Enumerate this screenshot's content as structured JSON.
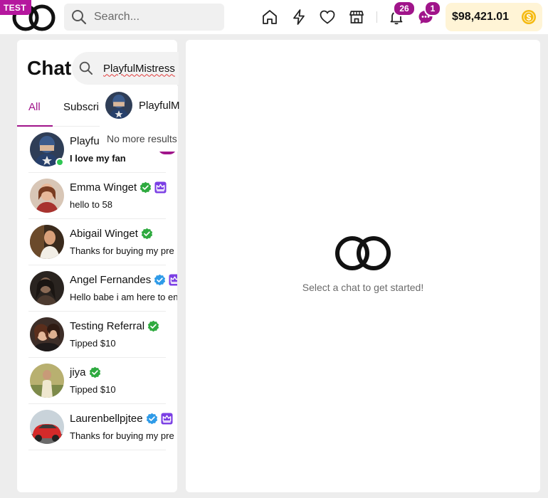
{
  "app": {
    "env_badge": "TEST",
    "logo_icon": "two-rings-logo-icon"
  },
  "header": {
    "search": {
      "placeholder": "Search..."
    },
    "nav_icons": [
      "home-icon",
      "lightning-icon",
      "heart-icon",
      "store-icon",
      "bell-icon",
      "message-icon"
    ],
    "notifications_count": "26",
    "messages_count": "1",
    "wallet_balance": "$98,421.01",
    "wallet_icon": "coin-icon"
  },
  "chat_panel": {
    "title": "Chat",
    "search_value": "PlayfulMistress",
    "tabs": [
      {
        "label": "All",
        "active": true
      },
      {
        "label": "Subscri",
        "active": false
      }
    ],
    "search_results": {
      "items": [
        {
          "name": "PlayfulM"
        }
      ],
      "end_text": "No more results"
    },
    "conversations": [
      {
        "name": "Playfu",
        "message": "I love my fan",
        "unread": true,
        "online": true,
        "verified": null,
        "crown": false
      },
      {
        "name": "Emma Winget",
        "message": "hello to 58",
        "unread": false,
        "online": false,
        "verified": "green",
        "crown": true
      },
      {
        "name": "Abigail Winget",
        "message": "Thanks for buying my pre",
        "unread": false,
        "online": false,
        "verified": "green",
        "crown": false
      },
      {
        "name": "Angel Fernandes",
        "message": "Hello babe i am here to en",
        "unread": false,
        "online": false,
        "verified": "blue",
        "crown": true
      },
      {
        "name": "Testing Referral",
        "message": "Tipped $10",
        "unread": false,
        "online": false,
        "verified": "green",
        "crown": false
      },
      {
        "name": "jiya",
        "message": "Tipped $10",
        "unread": false,
        "online": false,
        "verified": "green",
        "crown": false
      },
      {
        "name": "Laurenbellpjtee",
        "message": "Thanks for buying my pre",
        "unread": false,
        "online": false,
        "verified": "blue",
        "crown": true
      }
    ]
  },
  "main_panel": {
    "empty_text": "Select a chat to get started!"
  },
  "colors": {
    "accent": "#a0148a",
    "verified_green": "#2eaa3f",
    "verified_blue": "#2f9be8",
    "crown_purple": "#7b3fe4",
    "online_green": "#2fc653",
    "wallet_bg": "#fff4d6",
    "coin": "#f5b90e"
  }
}
